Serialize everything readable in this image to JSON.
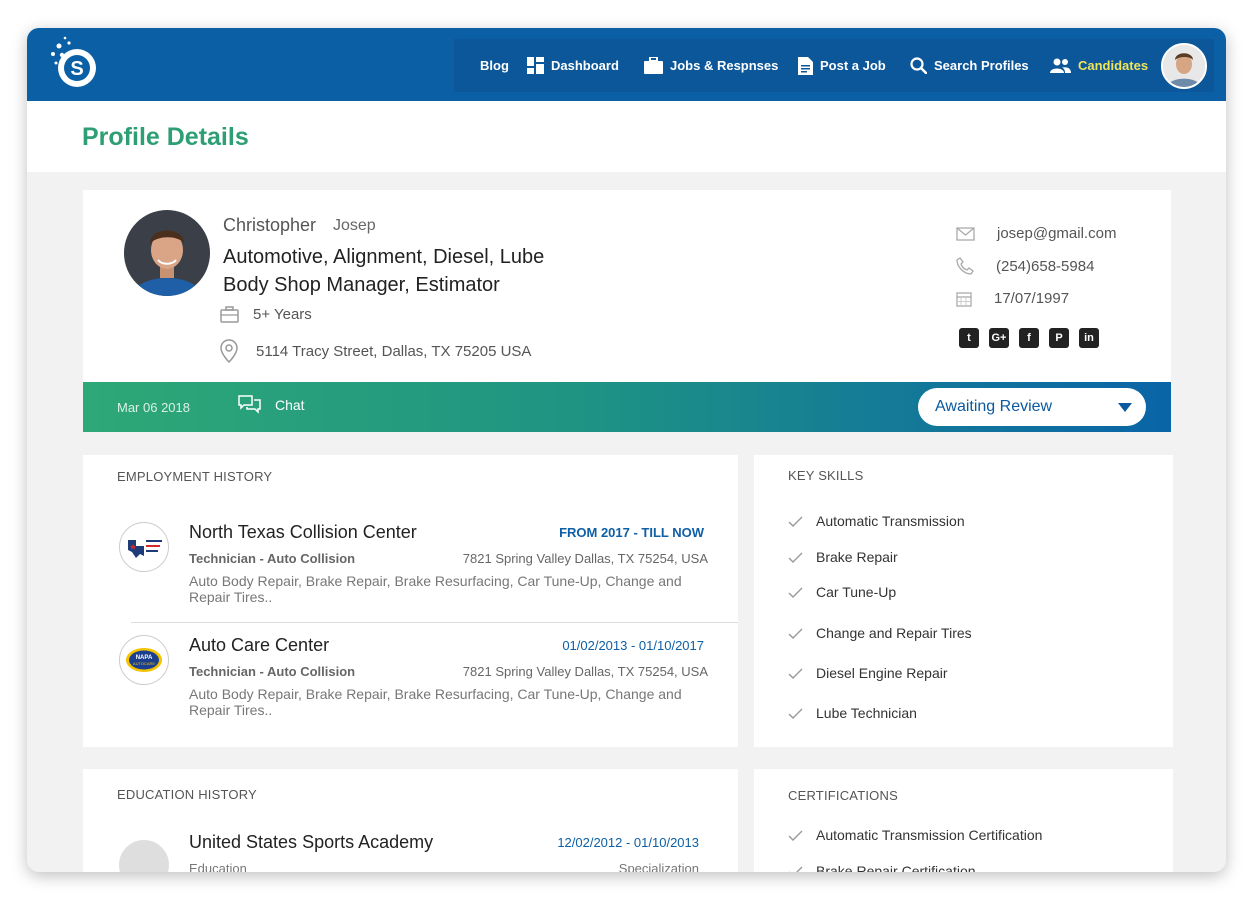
{
  "nav": {
    "items": [
      {
        "label": "Blog",
        "icon": "blog"
      },
      {
        "label": "Dashboard",
        "icon": "dashboard-icon"
      },
      {
        "label": "Jobs & Respnses",
        "icon": "briefcase-icon"
      },
      {
        "label": "Post a Job",
        "icon": "document-icon"
      },
      {
        "label": "Search Profiles",
        "icon": "search-icon"
      },
      {
        "label": "Candidates",
        "icon": "users-icon",
        "active": true
      }
    ],
    "active_color": "#f1e35a",
    "bar_color": "#0a5fa5"
  },
  "page": {
    "title": "Profile Details",
    "title_color": "#2e9e74"
  },
  "profile": {
    "first_name": "Christopher",
    "last_name": "Josep",
    "headline_line1": "Automotive, Alignment, Diesel, Lube",
    "headline_line2": "Body Shop Manager, Estimator",
    "experience": "5+ Years",
    "address": "5114 Tracy Street, Dallas, TX 75205 USA",
    "email": "josep@gmail.com",
    "phone": "(254)658-5984",
    "dob": "17/07/1997",
    "socials": [
      "twitter-icon",
      "google-plus-icon",
      "facebook-icon",
      "pinterest-icon",
      "linkedin-icon"
    ]
  },
  "status_bar": {
    "date": "Mar 06 2018",
    "chat_label": "Chat",
    "status_value": "Awaiting Review"
  },
  "employment": {
    "title": "EMPLOYMENT HISTORY",
    "jobs": [
      {
        "company": "North Texas Collision Center",
        "period": "FROM 2017 - TILL NOW",
        "role": "Technician - Auto Collision",
        "address": "7821 Spring Valley Dallas, TX 75254, USA",
        "description": "Auto Body Repair, Brake Repair, Brake Resurfacing, Car Tune-Up, Change and Repair Tires.."
      },
      {
        "company": "Auto Care Center",
        "period": "01/02/2013 - 01/10/2017",
        "role": "Technician - Auto Collision",
        "address": "7821 Spring Valley Dallas, TX 75254, USA",
        "description": "Auto Body Repair, Brake Repair, Brake Resurfacing, Car Tune-Up, Change and Repair Tires.."
      }
    ]
  },
  "skills": {
    "title": "KEY SKILLS",
    "items": [
      "Automatic Transmission",
      "Brake Repair",
      "Car Tune-Up",
      "Change and Repair Tires",
      "Diesel Engine Repair",
      "Lube Technician"
    ]
  },
  "education": {
    "title": "EDUCATION HISTORY",
    "school": "United States Sports Academy",
    "period": "12/02/2012 - 01/10/2013",
    "label_left": "Education",
    "label_right": "Specialization"
  },
  "certifications": {
    "title": "CERTIFICATIONS",
    "items": [
      "Automatic Transmission Certification",
      "Brake Repair Certification"
    ]
  }
}
